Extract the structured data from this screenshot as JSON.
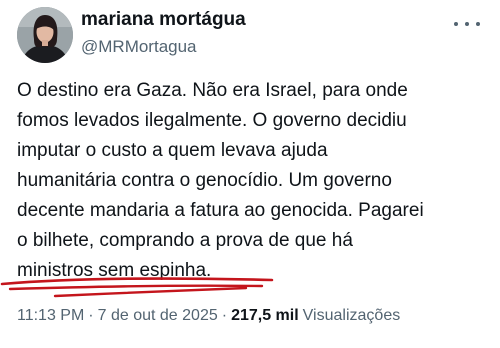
{
  "author": {
    "display_name": "mariana mortágua",
    "handle": "@MRMortagua"
  },
  "tweet": {
    "lines": [
      "O destino era Gaza. Não era Israel, para onde",
      "fomos levados ilegalmente. O governo decidiu",
      "imputar o custo a quem levava ajuda",
      "humanitária contra o genocídio. Um governo",
      "decente mandaria a fatura ao genocida. Pagarei",
      "o bilhete, comprando a prova de que há",
      "ministros sem espinha."
    ]
  },
  "meta": {
    "time": "11:13 PM",
    "separator": "·",
    "date": "7 de out de 2025",
    "views_count": "217,5 mil",
    "views_label": "Visualizações"
  },
  "icons": {
    "more": "more-horizontal-icon"
  },
  "colors": {
    "secondary_text": "#536471",
    "primary_text": "#0f1419",
    "handdrawn_underline": "#c4151c"
  }
}
